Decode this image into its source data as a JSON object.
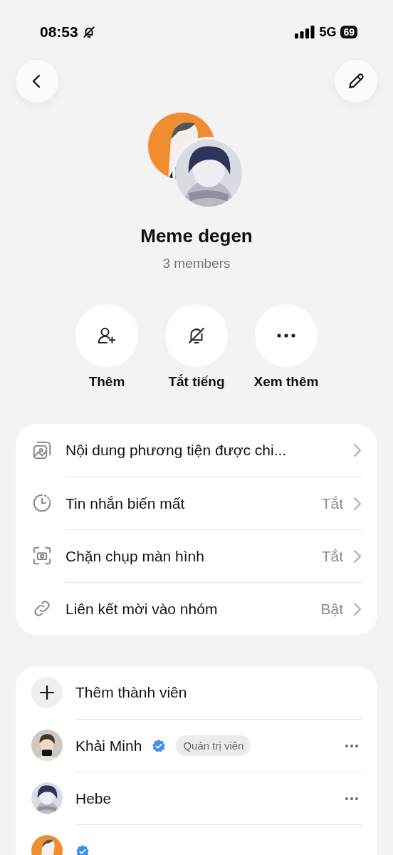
{
  "status_bar": {
    "time": "08:53",
    "silent": true,
    "network": "5G",
    "battery": "69"
  },
  "group": {
    "name": "Meme degen",
    "subtitle": "3 members"
  },
  "actions": [
    {
      "kind": "add-person",
      "label": "Thêm"
    },
    {
      "kind": "mute",
      "label": "Tắt tiếng"
    },
    {
      "kind": "more",
      "label": "Xem thêm"
    }
  ],
  "settings": [
    {
      "kind": "media",
      "label": "Nội dung phương tiện được chi..."
    },
    {
      "kind": "timer",
      "label": "Tin nhắn biến mất",
      "value": "Tắt"
    },
    {
      "kind": "screenshot",
      "label": "Chặn chụp màn hình",
      "value": "Tắt"
    },
    {
      "kind": "link",
      "label": "Liên kết mời vào nhóm",
      "value": "Bật"
    }
  ],
  "add_member": {
    "label": "Thêm thành viên"
  },
  "members": [
    {
      "name": "Khải Minh",
      "verified": true,
      "role": "Quản trị viên"
    },
    {
      "name": "Hebe",
      "verified": false
    },
    {
      "verified": true
    }
  ]
}
